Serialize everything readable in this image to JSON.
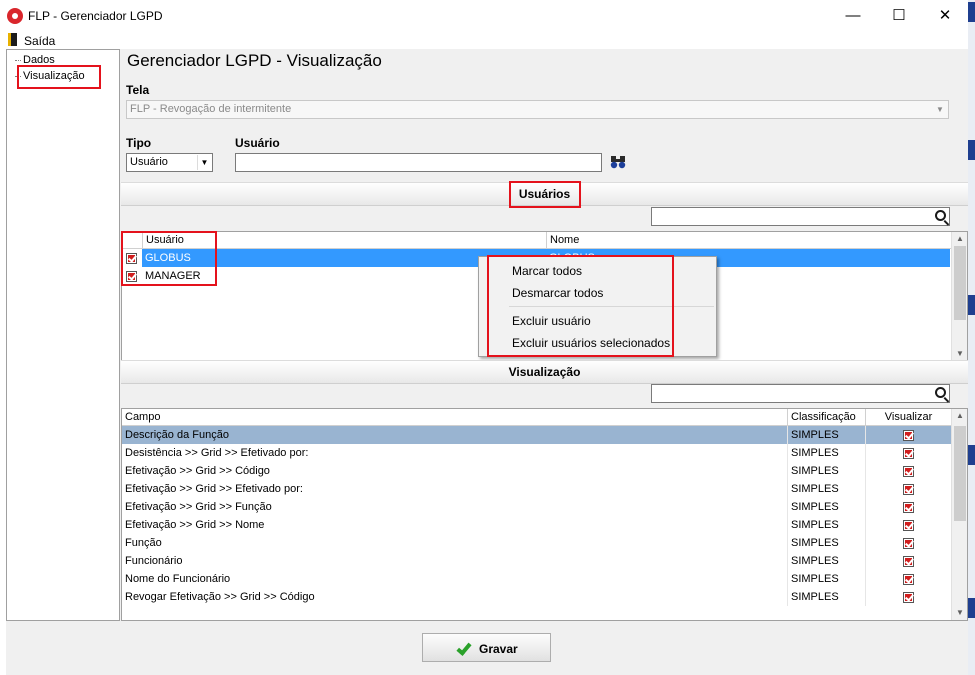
{
  "window": {
    "title": "FLP - Gerenciador LGPD",
    "minimize": "—",
    "maximize": "☐",
    "close": "✕"
  },
  "menu": {
    "exit_label": "Saída"
  },
  "tree": {
    "items": [
      "Dados",
      "Visualização"
    ]
  },
  "page": {
    "title": "Gerenciador LGPD - Visualização",
    "tela_label": "Tela",
    "tela_value": "FLP - Revogação de intermitente",
    "tipo_label": "Tipo",
    "tipo_value": "Usuário",
    "usuario_label": "Usuário",
    "usuario_value": ""
  },
  "users_section": {
    "title": "Usuários",
    "columns": [
      "Usuário",
      "Nome"
    ],
    "rows": [
      {
        "checked": true,
        "usuario": "GLOBUS",
        "nome": "GLOBUS",
        "selected": true
      },
      {
        "checked": true,
        "usuario": "MANAGER",
        "nome": "",
        "selected": false
      }
    ]
  },
  "context_menu": {
    "items": [
      "Marcar todos",
      "Desmarcar todos",
      "Excluir usuário",
      "Excluir usuários selecionados"
    ]
  },
  "view_section": {
    "title": "Visualização",
    "columns": [
      "Campo",
      "Classificação",
      "Visualizar"
    ],
    "rows": [
      {
        "campo": "Descrição da Função",
        "classificacao": "SIMPLES",
        "visualizar": true
      },
      {
        "campo": "Desistência >> Grid >> Efetivado por:",
        "classificacao": "SIMPLES",
        "visualizar": true
      },
      {
        "campo": "Efetivação >> Grid >> Código",
        "classificacao": "SIMPLES",
        "visualizar": true
      },
      {
        "campo": "Efetivação >> Grid >> Efetivado por:",
        "classificacao": "SIMPLES",
        "visualizar": true
      },
      {
        "campo": "Efetivação >> Grid >> Função",
        "classificacao": "SIMPLES",
        "visualizar": true
      },
      {
        "campo": "Efetivação >> Grid >> Nome",
        "classificacao": "SIMPLES",
        "visualizar": true
      },
      {
        "campo": "Função",
        "classificacao": "SIMPLES",
        "visualizar": true
      },
      {
        "campo": "Funcionário",
        "classificacao": "SIMPLES",
        "visualizar": true
      },
      {
        "campo": "Nome do Funcionário",
        "classificacao": "SIMPLES",
        "visualizar": true
      },
      {
        "campo": "Revogar Efetivação >> Grid >> Código",
        "classificacao": "SIMPLES",
        "visualizar": true
      }
    ]
  },
  "footer": {
    "save_label": "Gravar"
  },
  "colors": {
    "selection": "#3399ff",
    "row_highlight": "#99b4d1",
    "annotation": "#e4121c",
    "check": "#d01e1e"
  }
}
